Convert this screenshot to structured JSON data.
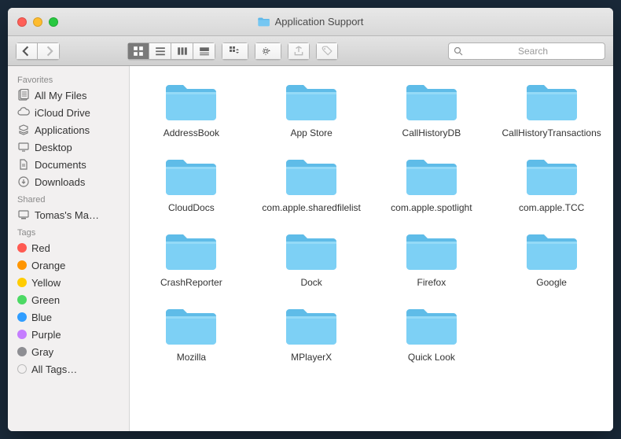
{
  "window": {
    "title": "Application Support"
  },
  "search": {
    "placeholder": "Search"
  },
  "sidebar": {
    "sections": [
      {
        "header": "Favorites",
        "items": [
          {
            "label": "All My Files",
            "icon": "all-files"
          },
          {
            "label": "iCloud Drive",
            "icon": "cloud"
          },
          {
            "label": "Applications",
            "icon": "apps"
          },
          {
            "label": "Desktop",
            "icon": "desktop"
          },
          {
            "label": "Documents",
            "icon": "documents"
          },
          {
            "label": "Downloads",
            "icon": "downloads"
          }
        ]
      },
      {
        "header": "Shared",
        "items": [
          {
            "label": "Tomas's Ma…",
            "icon": "computer"
          }
        ]
      },
      {
        "header": "Tags",
        "items": [
          {
            "label": "Red",
            "color": "#ff5a52"
          },
          {
            "label": "Orange",
            "color": "#ff9500"
          },
          {
            "label": "Yellow",
            "color": "#ffcc00"
          },
          {
            "label": "Green",
            "color": "#4cd964"
          },
          {
            "label": "Blue",
            "color": "#309dff"
          },
          {
            "label": "Purple",
            "color": "#c57dff"
          },
          {
            "label": "Gray",
            "color": "#8e8e93"
          },
          {
            "label": "All Tags…",
            "color": "",
            "empty": true
          }
        ]
      }
    ]
  },
  "folders": [
    "AddressBook",
    "App Store",
    "CallHistoryDB",
    "CallHistoryTransactions",
    "CloudDocs",
    "com.apple.sharedfilelist",
    "com.apple.spotlight",
    "com.apple.TCC",
    "CrashReporter",
    "Dock",
    "Firefox",
    "Google",
    "Mozilla",
    "MPlayerX",
    "Quick Look"
  ]
}
